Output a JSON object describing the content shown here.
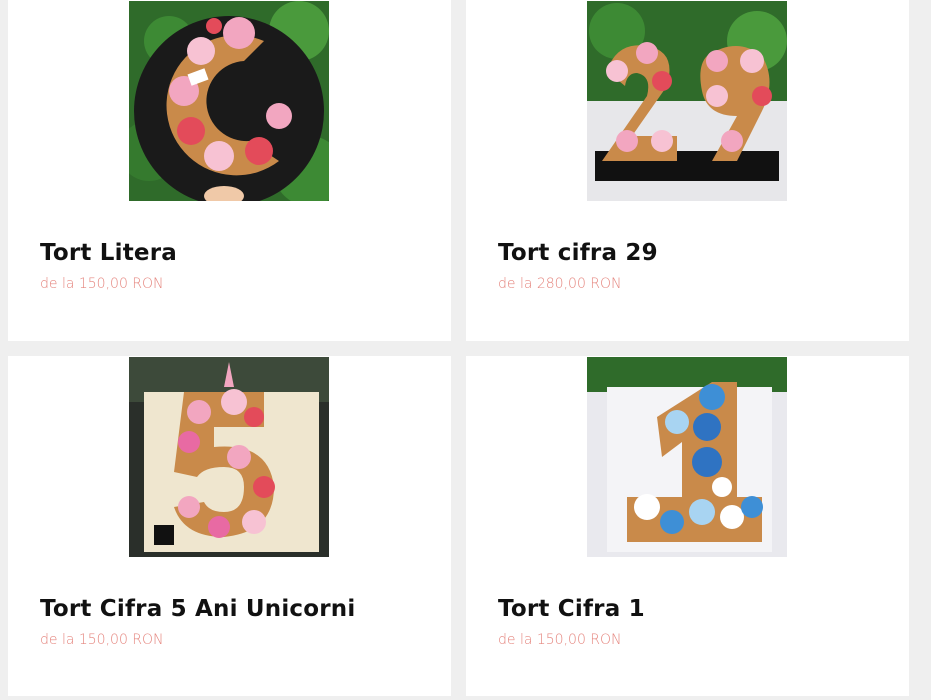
{
  "products": [
    {
      "title": "Tort Litera",
      "price": "de la 150,00 RON",
      "image": "cake-letter-c-image"
    },
    {
      "title": "Tort cifra 29",
      "price": "de la 280,00 RON",
      "image": "cake-number-29-image"
    },
    {
      "title": "Tort Cifra 5 Ani Unicorni",
      "price": "de la 150,00 RON",
      "image": "cake-number-5-unicorn-image"
    },
    {
      "title": "Tort Cifra 1",
      "price": "de la 150,00 RON",
      "image": "cake-number-1-blue-image"
    }
  ],
  "colors": {
    "page_bg": "#efefef",
    "card_bg": "#ffffff",
    "title": "#111111",
    "price": "#e5867f"
  }
}
